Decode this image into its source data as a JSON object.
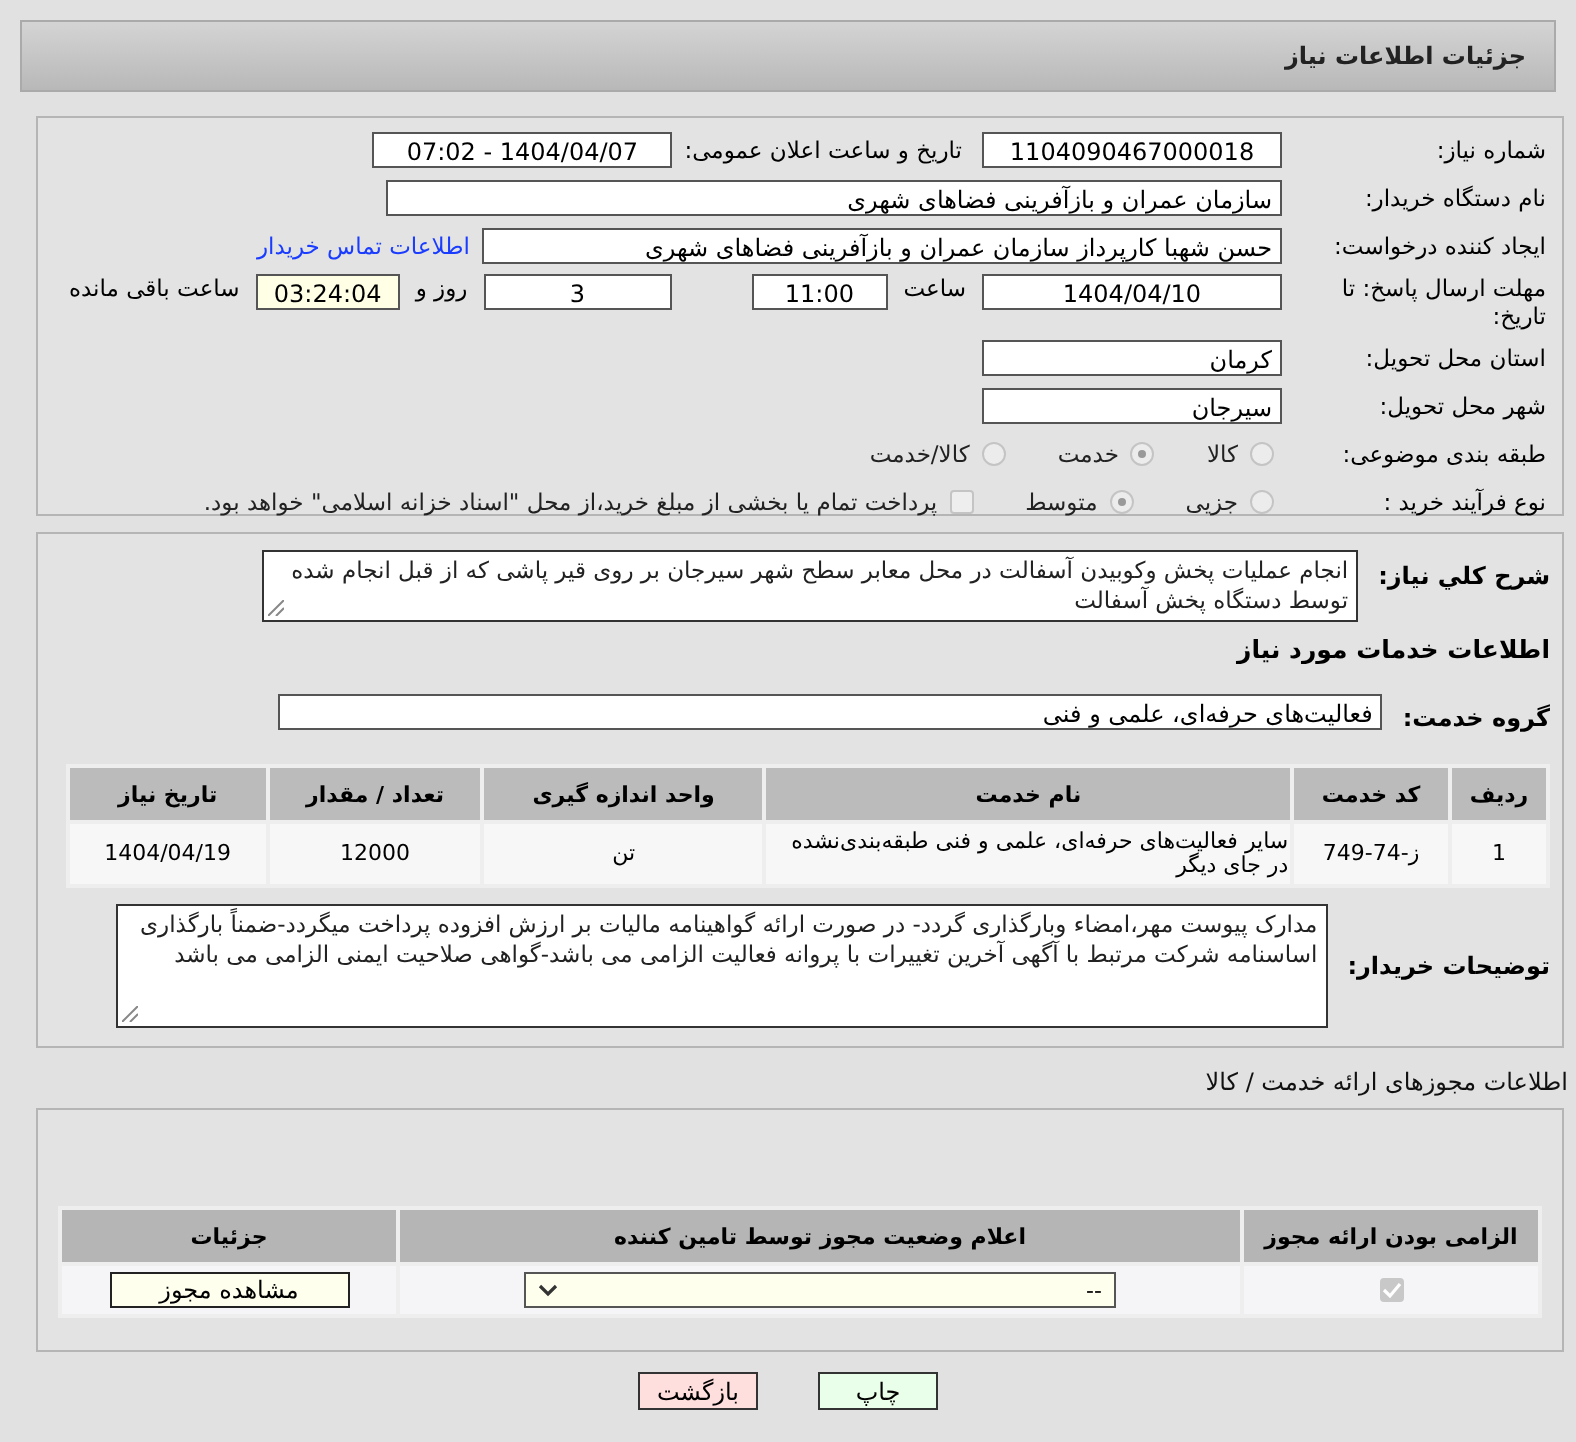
{
  "header": {
    "title": "جزئیات اطلاعات نیاز"
  },
  "need_number": {
    "label": "شماره نیاز:",
    "value": "1104090467000018"
  },
  "announce": {
    "label": "تاریخ و ساعت اعلان عمومی:",
    "value": "1404/04/07 - 07:02"
  },
  "buyer_org": {
    "label": "نام دستگاه خریدار:",
    "value": "سازمان عمران و بازآفرینی فضاهای شهری"
  },
  "requester": {
    "label": "ایجاد کننده درخواست:",
    "value": "حسن شهبا کارپرداز سازمان عمران و بازآفرینی فضاهای شهری",
    "link": "اطلاعات تماس خریدار"
  },
  "deadline": {
    "label": "مهلت ارسال پاسخ: تا تاریخ:",
    "date": "1404/04/10",
    "time_label": "ساعت",
    "time": "11:00",
    "days": "3",
    "days_label": "روز و",
    "remaining": "03:24:04",
    "remaining_label": "ساعت باقی مانده"
  },
  "province": {
    "label": "استان محل تحویل:",
    "value": "کرمان"
  },
  "city": {
    "label": "شهر محل تحویل:",
    "value": "سیرجان"
  },
  "category": {
    "label": "طبقه بندی موضوعی:",
    "options": [
      {
        "label": "کالا",
        "selected": false
      },
      {
        "label": "خدمت",
        "selected": true
      },
      {
        "label": "کالا/خدمت",
        "selected": false
      }
    ]
  },
  "process": {
    "label": "نوع فرآیند خرید :",
    "options": [
      {
        "label": "جزیی",
        "selected": false
      },
      {
        "label": "متوسط",
        "selected": true
      }
    ],
    "payment": {
      "checked": false,
      "text": "پرداخت تمام یا بخشی از مبلغ خرید،از محل \"اسناد خزانه اسلامی\" خواهد بود."
    }
  },
  "description": {
    "label": "شرح کلي نیاز:",
    "value": "انجام عملیات پخش وکوبیدن آسفالت در محل معابر سطح شهر سیرجان بر روی قیر پاشی که از قبل انجام شده توسط دستگاه پخش آسفالت"
  },
  "services_title": "اطلاعات خدمات مورد نیاز",
  "service_group": {
    "label": "گروه خدمت:",
    "value": "فعالیت‌های حرفه‌ای، علمی و فنی"
  },
  "table": {
    "columns": [
      "ردیف",
      "کد خدمت",
      "نام خدمت",
      "واحد اندازه گیری",
      "تعداد / مقدار",
      "تاریخ نیاز"
    ],
    "rows": [
      [
        "1",
        "ز-74-749",
        "سایر فعالیت‌های حرفه‌ای، علمی و فنی طبقه‌بندی‌نشده در جای دیگر",
        "تن",
        "12000",
        "1404/04/19"
      ]
    ]
  },
  "buyer_notes": {
    "label": "توضیحات خریدار:",
    "value": "مدارک پیوست مهر،امضاء وبارگذاری گردد- در صورت ارائه گواهینامه مالیات بر ارزش افزوده پرداخت میگردد-ضمناً بارگذاری اساسنامه شرکت مرتبط با آگهی آخرین تغییرات با پروانه فعالیت الزامی می باشد-گواهی صلاحیت ایمنی الزامی می باشد"
  },
  "permits": {
    "title": "اطلاعات مجوزهای ارائه خدمت / کالا",
    "columns": [
      "الزامی بودن ارائه مجوز",
      "اعلام وضعیت مجوز توسط تامین کننده",
      "جزئیات"
    ],
    "rows": [
      {
        "required": true,
        "status": "--",
        "button": "مشاهده مجوز"
      }
    ]
  },
  "buttons": [
    {
      "label": "چاپ",
      "kind": "print"
    },
    {
      "label": "بازگشت",
      "kind": "back"
    }
  ]
}
